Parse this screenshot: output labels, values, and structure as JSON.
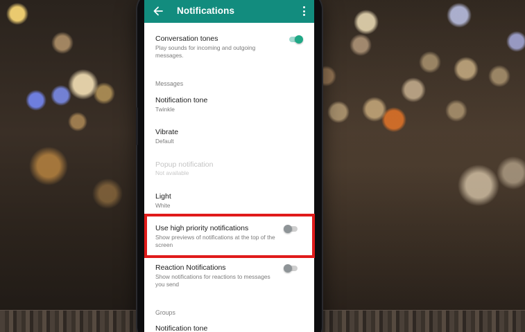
{
  "app_bar": {
    "title": "Notifications",
    "color": "#128c7e"
  },
  "icons": [
    "arrow-back-icon",
    "more-vert-icon"
  ],
  "rows": {
    "conversation_tones": {
      "title": "Conversation tones",
      "subtitle": "Play sounds for incoming and outgoing messages.",
      "toggle": "on"
    },
    "messages_header": "Messages",
    "notification_tone": {
      "title": "Notification tone",
      "subtitle": "Twinkle"
    },
    "vibrate": {
      "title": "Vibrate",
      "subtitle": "Default"
    },
    "popup_notification": {
      "title": "Popup notification",
      "subtitle": "Not available",
      "disabled": true
    },
    "light": {
      "title": "Light",
      "subtitle": "White"
    },
    "high_priority": {
      "title": "Use high priority notifications",
      "subtitle": "Show previews of notifications at the top of the screen",
      "toggle": "off",
      "highlighted": true
    },
    "reaction_notifications": {
      "title": "Reaction Notifications",
      "subtitle": "Show notifications for reactions to messages you send",
      "toggle": "off"
    },
    "groups_header": "Groups",
    "group_notification_tone": {
      "title": "Notification tone"
    }
  },
  "colors": {
    "highlight": "#e01b1b",
    "toggle_on": "#1fa886",
    "toggle_off": "#8e9497"
  }
}
